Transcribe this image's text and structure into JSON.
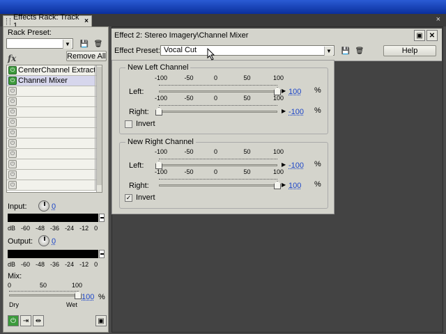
{
  "window": {
    "tab_title": "Effects Rack: Track 1",
    "tab_close": "×",
    "close": "×"
  },
  "rack": {
    "preset_label": "Rack Preset:",
    "preset_value": "",
    "fx_label": "fx",
    "remove_all": "Remove All",
    "slots": [
      {
        "name": "CenterChannel Extracto",
        "on": true
      },
      {
        "name": "Channel Mixer",
        "on": true,
        "selected": true
      },
      {
        "name": "",
        "on": false
      },
      {
        "name": "",
        "on": false
      },
      {
        "name": "",
        "on": false
      },
      {
        "name": "",
        "on": false
      },
      {
        "name": "",
        "on": false
      },
      {
        "name": "",
        "on": false
      },
      {
        "name": "",
        "on": false
      },
      {
        "name": "",
        "on": false
      },
      {
        "name": "",
        "on": false
      },
      {
        "name": "",
        "on": false
      }
    ],
    "input_label": "Input:",
    "input_value": "0",
    "output_label": "Output:",
    "output_value": "0",
    "meter_scale": [
      "dB",
      "-60",
      "-48",
      "-36",
      "-24",
      "-12",
      "0"
    ],
    "mix_label": "Mix:",
    "mix_scale": [
      "0",
      "50",
      "100"
    ],
    "mix_value": "100",
    "mix_pct": "%",
    "mix_dry": "Dry",
    "mix_wet": "Wet"
  },
  "effect": {
    "title": "Effect 2: Stereo Imagery\\Channel Mixer",
    "preset_label": "Effect Preset:",
    "preset_value": "Vocal Cut",
    "help": "Help",
    "scale": [
      "-100",
      "-50",
      "0",
      "50",
      "100"
    ],
    "left_group": {
      "title": "New Left Channel",
      "left_label": "Left:",
      "left_value": "100",
      "left_level": 100,
      "right_label": "Right:",
      "right_value": "-100",
      "right_level": -100,
      "invert_label": "Invert",
      "invert": false
    },
    "right_group": {
      "title": "New Right Channel",
      "left_label": "Left:",
      "left_value": "-100",
      "left_level": -100,
      "right_label": "Right:",
      "right_value": "100",
      "right_level": 100,
      "invert_label": "Invert",
      "invert": true
    },
    "pct": "%"
  },
  "colors": {
    "accent": "#1a44c8",
    "power_on": "#3c9a3c",
    "title_bar": "#0a2f9c"
  }
}
